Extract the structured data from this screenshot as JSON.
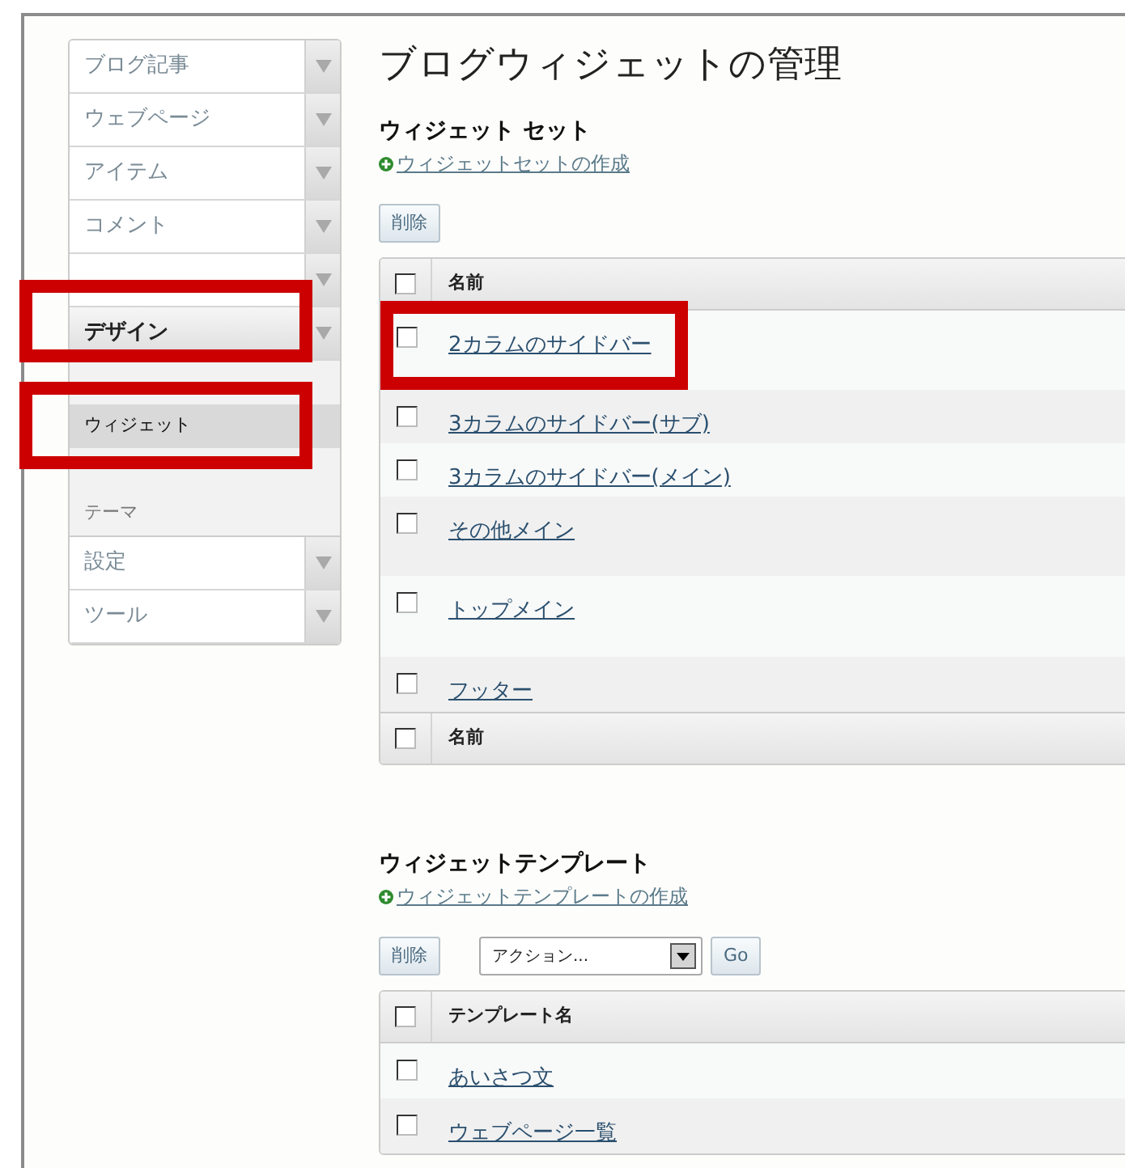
{
  "page_title": "ブログウィジェットの管理",
  "sidebar": {
    "items": [
      {
        "label": "ブログ記事",
        "expanded": false
      },
      {
        "label": "ウェブページ",
        "expanded": false
      },
      {
        "label": "アイテム",
        "expanded": false
      },
      {
        "label": "コメント",
        "expanded": false
      },
      {
        "expanded": false
      },
      {
        "label": "デザイン",
        "expanded": true,
        "children": [
          {
            "selected": false
          },
          {
            "label": "ウィジェット",
            "selected": true
          },
          {
            "selected": false
          },
          {
            "label": "テーマ",
            "selected": false
          }
        ]
      },
      {
        "label": "設定",
        "expanded": false
      },
      {
        "label": "ツール",
        "expanded": false
      }
    ]
  },
  "sections": [
    {
      "title": "ウィジェット セット",
      "create_link": "ウィジェットセットの作成",
      "delete_button": "削除",
      "table": {
        "column": "名前",
        "header_checked": false,
        "footer_column": "名前",
        "footer_checked": false,
        "rows": [
          {
            "name": "2カラムのサイドバー",
            "checked": false
          },
          {
            "name": "3カラムのサイドバー(サブ)",
            "checked": false
          },
          {
            "name": "3カラムのサイドバー(メイン)",
            "checked": false
          },
          {
            "name": "その他メイン",
            "checked": false
          },
          {
            "name": "トップメイン",
            "checked": false
          },
          {
            "name": "フッター",
            "checked": false
          }
        ]
      }
    },
    {
      "title": "ウィジェットテンプレート",
      "create_link": "ウィジェットテンプレートの作成",
      "delete_button": "削除",
      "action_select": {
        "value": "アクション..."
      },
      "go_button": "Go",
      "table": {
        "column": "テンプレート名",
        "header_checked": false,
        "rows": [
          {
            "name": "あいさつ文",
            "checked": false
          },
          {
            "name": "ウェブページ一覧",
            "checked": false
          }
        ]
      }
    }
  ]
}
